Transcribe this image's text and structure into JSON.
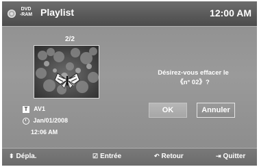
{
  "header": {
    "disc_line1": "DVD",
    "disc_line2": "-RAM",
    "title": "Playlist",
    "time": "12:00 AM"
  },
  "preview": {
    "page": "2/2",
    "source": "AV1",
    "date": "Jan/01/2008",
    "time": "12:06 AM"
  },
  "dialog": {
    "line1": "Désirez-vous effacer le",
    "line2": "《n° 02》?",
    "ok_label": "OK",
    "cancel_label": "Annuler"
  },
  "footer": {
    "move_label": "Dépla.",
    "enter_label": "Entrée",
    "return_label": "Retour",
    "exit_label": "Quitter"
  }
}
